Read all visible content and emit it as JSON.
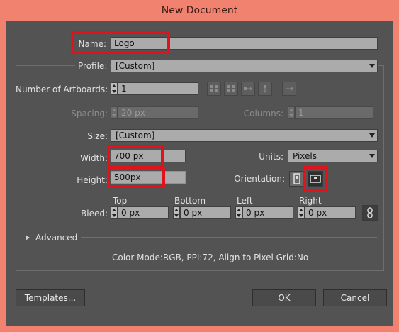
{
  "window": {
    "title": "New Document"
  },
  "name": {
    "label": "Name:",
    "value": "Logo"
  },
  "profile": {
    "label": "Profile:",
    "value": "[Custom]"
  },
  "artboards": {
    "label": "Number of Artboards:",
    "value": "1"
  },
  "spacing": {
    "label": "Spacing:",
    "value": "20 px"
  },
  "columns": {
    "label": "Columns:",
    "value": "1"
  },
  "size": {
    "label": "Size:",
    "value": "[Custom]"
  },
  "width": {
    "label": "Width:",
    "value": "700 px"
  },
  "units": {
    "label": "Units:",
    "value": "Pixels"
  },
  "height": {
    "label": "Height:",
    "value": "500px"
  },
  "orientation": {
    "label": "Orientation:",
    "selected": "landscape"
  },
  "bleed": {
    "label": "Bleed:",
    "top": {
      "label": "Top",
      "value": "0 px"
    },
    "bottom": {
      "label": "Bottom",
      "value": "0 px"
    },
    "left": {
      "label": "Left",
      "value": "0 px"
    },
    "right": {
      "label": "Right",
      "value": "0 px"
    }
  },
  "advanced": {
    "label": "Advanced"
  },
  "info": "Color Mode:RGB, PPI:72, Align to Pixel Grid:No",
  "buttons": {
    "templates": "Templates...",
    "ok": "OK",
    "cancel": "Cancel"
  },
  "colors": {
    "highlight": "#e0121c",
    "background": "#f1826f",
    "panel": "#535353"
  }
}
